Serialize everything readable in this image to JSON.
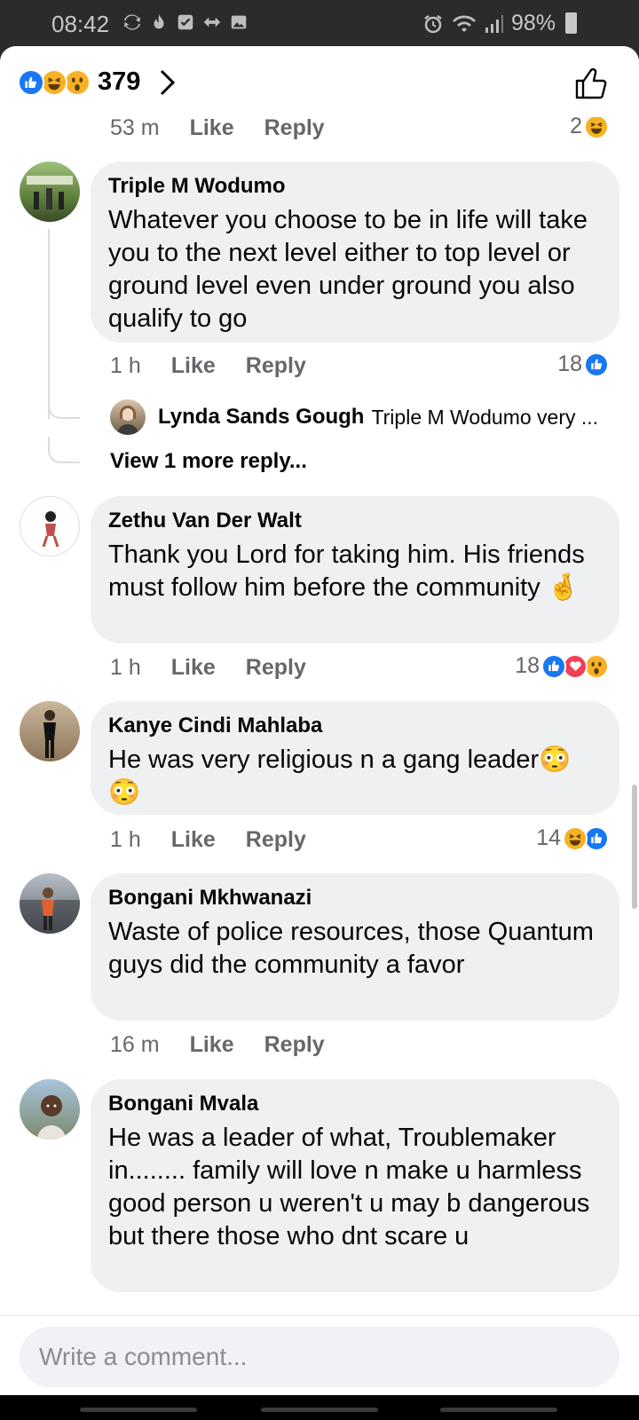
{
  "status_bar": {
    "time": "08:42",
    "battery": "98%",
    "left_icons": [
      "sync-icon",
      "fire-icon",
      "check-box-icon",
      "arrows-icon",
      "image-icon"
    ],
    "right_icons": [
      "alarm-icon",
      "wifi-icon",
      "signal-icon",
      "battery-icon"
    ]
  },
  "reactions_header": {
    "count": "379",
    "icons": [
      "like-reaction-icon",
      "haha-reaction-icon",
      "wow-reaction-icon"
    ]
  },
  "top_meta": {
    "time": "53 m",
    "like": "Like",
    "reply": "Reply",
    "reaction_count": "2",
    "reaction_icons": [
      "haha-reaction-icon"
    ]
  },
  "comments": [
    {
      "name": "Triple M Wodumo",
      "text": "Whatever you choose to be in life will take you to the next level either to top level or ground level even under ground you also qualify to go",
      "time": "1 h",
      "like": "Like",
      "reply": "Reply",
      "reaction_count": "18",
      "reaction_icons": [
        "like-reaction-icon"
      ],
      "reply_preview": {
        "name": "Lynda Sands Gough",
        "text": "Triple M Wodumo very ..."
      },
      "more_replies": "View 1 more reply..."
    },
    {
      "name": "Zethu Van Der Walt",
      "text": "Thank you Lord for taking him. His friends must follow him before the community 🤞",
      "time": "1 h",
      "like": "Like",
      "reply": "Reply",
      "reaction_count": "18",
      "reaction_icons": [
        "like-reaction-icon",
        "love-reaction-icon",
        "wow-reaction-icon"
      ]
    },
    {
      "name": "Kanye Cindi Mahlaba",
      "text": "He was very religious n a gang leader😳 😳",
      "time": "1 h",
      "like": "Like",
      "reply": "Reply",
      "reaction_count": "14",
      "reaction_icons": [
        "haha-reaction-icon",
        "like-reaction-icon"
      ]
    },
    {
      "name": "Bongani Mkhwanazi",
      "text": "Waste of police resources, those Quantum guys did the community a favor",
      "time": "16 m",
      "like": "Like",
      "reply": "Reply",
      "reaction_count": "",
      "reaction_icons": []
    },
    {
      "name": "Bongani Mvala",
      "text": "He was a leader of what, Troublemaker in........ family will love n make u harmless good person u weren't u may b dangerous but there those who dnt scare u"
    }
  ],
  "composer": {
    "placeholder": "Write a comment..."
  }
}
